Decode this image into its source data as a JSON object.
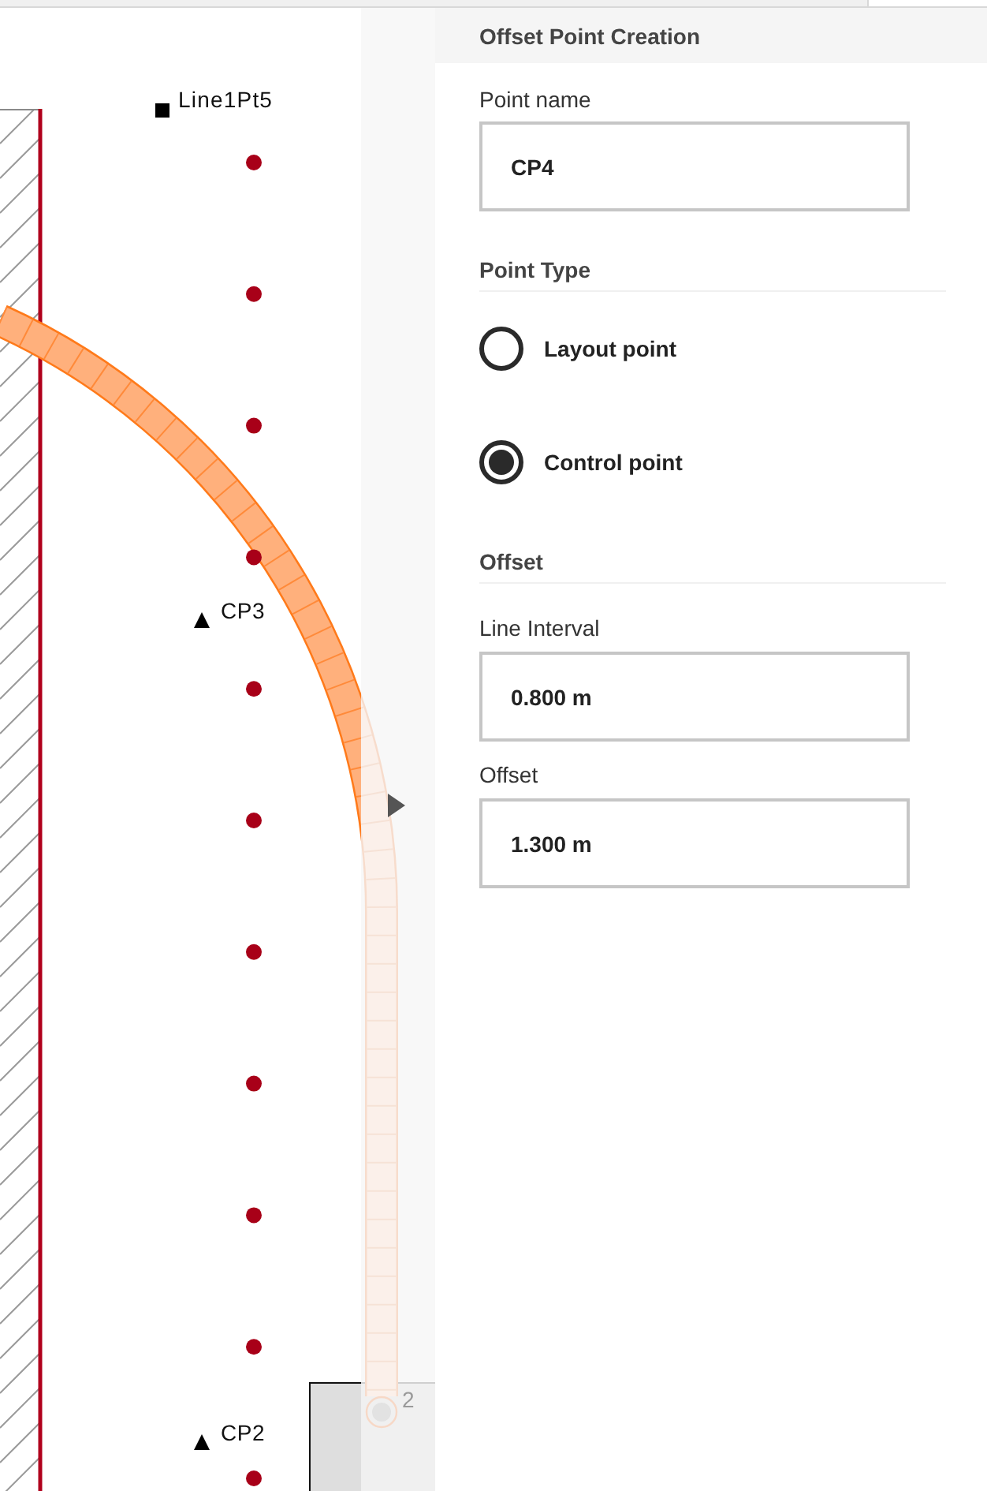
{
  "canvas": {
    "markers": [
      {
        "kind": "square",
        "label": "Line1Pt5"
      },
      {
        "kind": "triangle",
        "label": "CP3"
      },
      {
        "kind": "triangle",
        "label": "CP2"
      },
      {
        "kind": "circle",
        "label": "2"
      }
    ]
  },
  "panel": {
    "title": "Offset Point Creation",
    "point_name": {
      "label": "Point name",
      "value": "CP4"
    },
    "point_type": {
      "heading": "Point Type",
      "options": [
        {
          "label": "Layout point",
          "selected": false
        },
        {
          "label": "Control point",
          "selected": true
        }
      ]
    },
    "offset": {
      "heading": "Offset",
      "fields": [
        {
          "label": "Line Interval",
          "value": "0.800 m"
        },
        {
          "label": "Offset",
          "value": "1.300 m"
        }
      ]
    }
  }
}
